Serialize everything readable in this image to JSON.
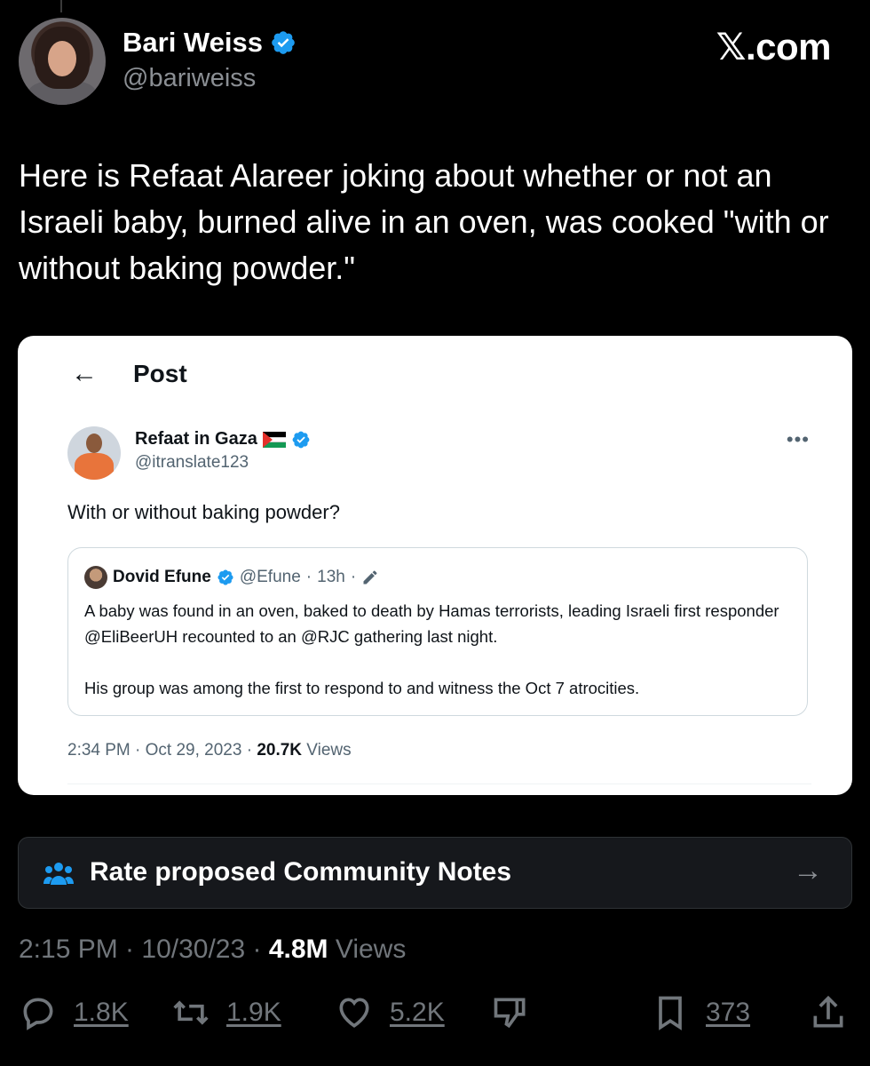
{
  "author": {
    "name": "Bari Weiss",
    "handle": "@bariweiss"
  },
  "brand": {
    "label": "𝕏.com"
  },
  "tweet": {
    "text": "Here is Refaat Alareer joking about whether or not an Israeli baby, burned alive in an oven, was cooked \"with or without baking powder.\""
  },
  "embedded_post": {
    "header_title": "Post",
    "author_name": "Refaat in Gaza",
    "author_handle": "@itranslate123",
    "text": "With or without baking powder?",
    "quote": {
      "author_name": "Dovid Efune",
      "author_handle": "@Efune",
      "time": "13h",
      "paragraph1": "A baby was found in an oven, baked to death by Hamas terrorists, leading Israeli first responder @EliBeerUH recounted to an @RJC gathering last night.",
      "paragraph2": "His group was among the first to respond to and witness the Oct 7 atrocities."
    },
    "meta_time": "2:34 PM · Oct 29, 2023 · ",
    "views_count": "20.7K",
    "views_label": " Views"
  },
  "community_notes": {
    "label": "Rate proposed Community Notes"
  },
  "meta": {
    "time": "2:15 PM · 10/30/23 · ",
    "views_count": "4.8M",
    "views_label": " Views"
  },
  "actions": {
    "replies": "1.8K",
    "reposts": "1.9K",
    "likes": "5.2K",
    "bookmarks": "373"
  },
  "colors": {
    "background": "#000000",
    "verified_blue": "#1d9bf0",
    "muted": "#71767b"
  }
}
